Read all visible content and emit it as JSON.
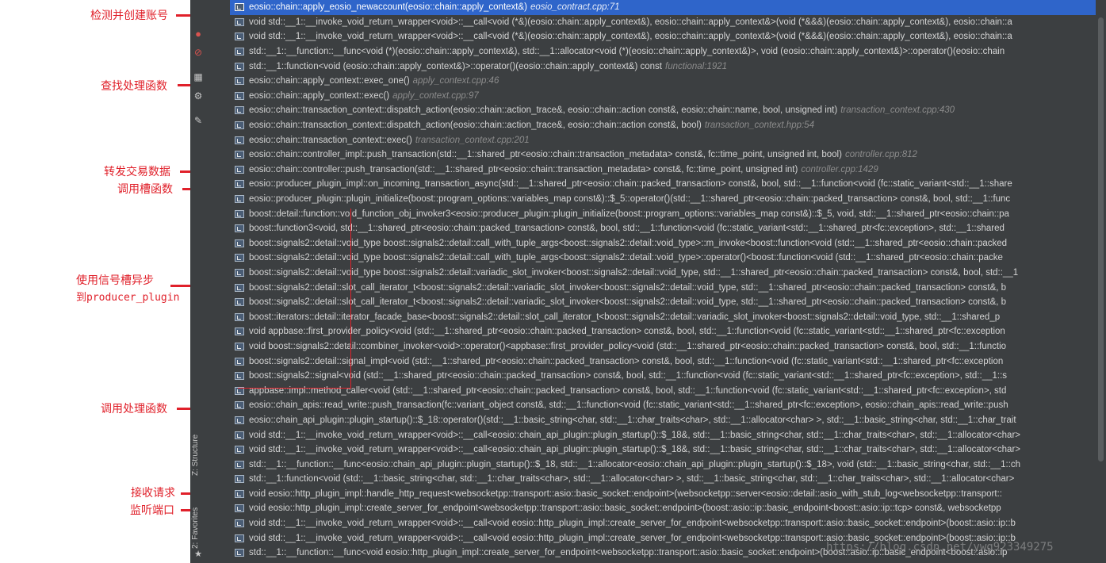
{
  "annotations": [
    {
      "label": "检测并创建账号"
    },
    {
      "label": "查找处理函数"
    },
    {
      "label": "转发交易数据"
    },
    {
      "label": "调用槽函数"
    },
    {
      "label": "使用信号槽异步"
    },
    {
      "label": "到producer_plugin"
    },
    {
      "label": "调用处理函数"
    },
    {
      "label": "接收请求"
    },
    {
      "label": "监听端口"
    }
  ],
  "sidebar": {
    "structure_tab": "Z: Structure",
    "favorites_tab": "2: Favorites"
  },
  "watermark": "https://blog.csdn.net/ywq923349275",
  "frames": [
    {
      "method": "eosio::chain::apply_eosio_newaccount(eosio::chain::apply_context&)",
      "loc": "eosio_contract.cpp:71",
      "selected": true
    },
    {
      "method": "void std::__1::__invoke_void_return_wrapper<void>::__call<void (*&)(eosio::chain::apply_context&), eosio::chain::apply_context&>(void (*&&&)(eosio::chain::apply_context&), eosio::chain::a",
      "loc": ""
    },
    {
      "method": "void std::__1::__invoke_void_return_wrapper<void>::__call<void (*&)(eosio::chain::apply_context&), eosio::chain::apply_context&>(void (*&&&)(eosio::chain::apply_context&), eosio::chain::a",
      "loc": ""
    },
    {
      "method": "std::__1::__function::__func<void (*)(eosio::chain::apply_context&), std::__1::allocator<void (*)(eosio::chain::apply_context&)>, void (eosio::chain::apply_context&)>::operator()(eosio::chain",
      "loc": ""
    },
    {
      "method": "std::__1::function<void (eosio::chain::apply_context&)>::operator()(eosio::chain::apply_context&) const",
      "loc": "functional:1921"
    },
    {
      "method": "eosio::chain::apply_context::exec_one()",
      "loc": "apply_context.cpp:46"
    },
    {
      "method": "eosio::chain::apply_context::exec()",
      "loc": "apply_context.cpp:97"
    },
    {
      "method": "eosio::chain::transaction_context::dispatch_action(eosio::chain::action_trace&, eosio::chain::action const&, eosio::chain::name, bool, unsigned int)",
      "loc": "transaction_context.cpp:430"
    },
    {
      "method": "eosio::chain::transaction_context::dispatch_action(eosio::chain::action_trace&, eosio::chain::action const&, bool)",
      "loc": "transaction_context.hpp:54"
    },
    {
      "method": "eosio::chain::transaction_context::exec()",
      "loc": "transaction_context.cpp:201"
    },
    {
      "method": "eosio::chain::controller_impl::push_transaction(std::__1::shared_ptr<eosio::chain::transaction_metadata> const&, fc::time_point, unsigned int, bool)",
      "loc": "controller.cpp:812"
    },
    {
      "method": "eosio::chain::controller::push_transaction(std::__1::shared_ptr<eosio::chain::transaction_metadata> const&, fc::time_point, unsigned int)",
      "loc": "controller.cpp:1429"
    },
    {
      "method": "eosio::producer_plugin_impl::on_incoming_transaction_async(std::__1::shared_ptr<eosio::chain::packed_transaction> const&, bool, std::__1::function<void (fc::static_variant<std::__1::share",
      "loc": ""
    },
    {
      "method": "eosio::producer_plugin::plugin_initialize(boost::program_options::variables_map const&)::$_5::operator()(std::__1::shared_ptr<eosio::chain::packed_transaction> const&, bool, std::__1::func",
      "loc": ""
    },
    {
      "method": "boost::detail::function::void_function_obj_invoker3<eosio::producer_plugin::plugin_initialize(boost::program_options::variables_map const&)::$_5, void, std::__1::shared_ptr<eosio::chain::pa",
      "loc": ""
    },
    {
      "method": "boost::function3<void, std::__1::shared_ptr<eosio::chain::packed_transaction> const&, bool, std::__1::function<void (fc::static_variant<std::__1::shared_ptr<fc::exception>, std::__1::shared",
      "loc": ""
    },
    {
      "method": "boost::signals2::detail::void_type boost::signals2::detail::call_with_tuple_args<boost::signals2::detail::void_type>::m_invoke<boost::function<void (std::__1::shared_ptr<eosio::chain::packed",
      "loc": ""
    },
    {
      "method": "boost::signals2::detail::void_type boost::signals2::detail::call_with_tuple_args<boost::signals2::detail::void_type>::operator()<boost::function<void (std::__1::shared_ptr<eosio::chain::packe",
      "loc": ""
    },
    {
      "method": "boost::signals2::detail::void_type boost::signals2::detail::variadic_slot_invoker<boost::signals2::detail::void_type, std::__1::shared_ptr<eosio::chain::packed_transaction> const&, bool, std::__1",
      "loc": ""
    },
    {
      "method": "boost::signals2::detail::slot_call_iterator_t<boost::signals2::detail::variadic_slot_invoker<boost::signals2::detail::void_type, std::__1::shared_ptr<eosio::chain::packed_transaction> const&, b",
      "loc": ""
    },
    {
      "method": "boost::signals2::detail::slot_call_iterator_t<boost::signals2::detail::variadic_slot_invoker<boost::signals2::detail::void_type, std::__1::shared_ptr<eosio::chain::packed_transaction> const&, b",
      "loc": ""
    },
    {
      "method": "boost::iterators::detail::iterator_facade_base<boost::signals2::detail::slot_call_iterator_t<boost::signals2::detail::variadic_slot_invoker<boost::signals2::detail::void_type, std::__1::shared_p",
      "loc": ""
    },
    {
      "method": "void appbase::first_provider_policy<void (std::__1::shared_ptr<eosio::chain::packed_transaction> const&, bool, std::__1::function<void (fc::static_variant<std::__1::shared_ptr<fc::exception",
      "loc": ""
    },
    {
      "method": "void boost::signals2::detail::combiner_invoker<void>::operator()<appbase::first_provider_policy<void (std::__1::shared_ptr<eosio::chain::packed_transaction> const&, bool, std::__1::functio",
      "loc": ""
    },
    {
      "method": "boost::signals2::detail::signal_impl<void (std::__1::shared_ptr<eosio::chain::packed_transaction> const&, bool, std::__1::function<void (fc::static_variant<std::__1::shared_ptr<fc::exception",
      "loc": ""
    },
    {
      "method": "boost::signals2::signal<void (std::__1::shared_ptr<eosio::chain::packed_transaction> const&, bool, std::__1::function<void (fc::static_variant<std::__1::shared_ptr<fc::exception>, std::__1::s",
      "loc": ""
    },
    {
      "method": "appbase::impl::method_caller<void (std::__1::shared_ptr<eosio::chain::packed_transaction> const&, bool, std::__1::function<void (fc::static_variant<std::__1::shared_ptr<fc::exception>, std",
      "loc": ""
    },
    {
      "method": "eosio::chain_apis::read_write::push_transaction(fc::variant_object const&, std::__1::function<void (fc::static_variant<std::__1::shared_ptr<fc::exception>, eosio::chain_apis::read_write::push",
      "loc": ""
    },
    {
      "method": "eosio::chain_api_plugin::plugin_startup()::$_18::operator()(std::__1::basic_string<char, std::__1::char_traits<char>, std::__1::allocator<char> >, std::__1::basic_string<char, std::__1::char_trait",
      "loc": ""
    },
    {
      "method": "void std::__1::__invoke_void_return_wrapper<void>::__call<eosio::chain_api_plugin::plugin_startup()::$_18&, std::__1::basic_string<char, std::__1::char_traits<char>, std::__1::allocator<char>",
      "loc": ""
    },
    {
      "method": "void std::__1::__invoke_void_return_wrapper<void>::__call<eosio::chain_api_plugin::plugin_startup()::$_18&, std::__1::basic_string<char, std::__1::char_traits<char>, std::__1::allocator<char>",
      "loc": ""
    },
    {
      "method": "std::__1::__function::__func<eosio::chain_api_plugin::plugin_startup()::$_18, std::__1::allocator<eosio::chain_api_plugin::plugin_startup()::$_18>, void (std::__1::basic_string<char, std::__1::ch",
      "loc": ""
    },
    {
      "method": "std::__1::function<void (std::__1::basic_string<char, std::__1::char_traits<char>, std::__1::allocator<char> >, std::__1::basic_string<char, std::__1::char_traits<char>, std::__1::allocator<char>",
      "loc": ""
    },
    {
      "method": "void eosio::http_plugin_impl::handle_http_request<websocketpp::transport::asio::basic_socket::endpoint>(websocketpp::server<eosio::detail::asio_with_stub_log<websocketpp::transport::",
      "loc": ""
    },
    {
      "method": "void eosio::http_plugin_impl::create_server_for_endpoint<websocketpp::transport::asio::basic_socket::endpoint>(boost::asio::ip::basic_endpoint<boost::asio::ip::tcp> const&, websocketpp",
      "loc": ""
    },
    {
      "method": "void std::__1::__invoke_void_return_wrapper<void>::__call<void eosio::http_plugin_impl::create_server_for_endpoint<websocketpp::transport::asio::basic_socket::endpoint>(boost::asio::ip::b",
      "loc": ""
    },
    {
      "method": "void std::__1::__invoke_void_return_wrapper<void>::__call<void eosio::http_plugin_impl::create_server_for_endpoint<websocketpp::transport::asio::basic_socket::endpoint>(boost::asio::ip::b",
      "loc": ""
    },
    {
      "method": "std::__1::__function::__func<void eosio::http_plugin_impl::create_server_for_endpoint<websocketpp::transport::asio::basic_socket::endpoint>(boost::asio::ip::basic_endpoint<boost::asio::ip",
      "loc": ""
    }
  ]
}
